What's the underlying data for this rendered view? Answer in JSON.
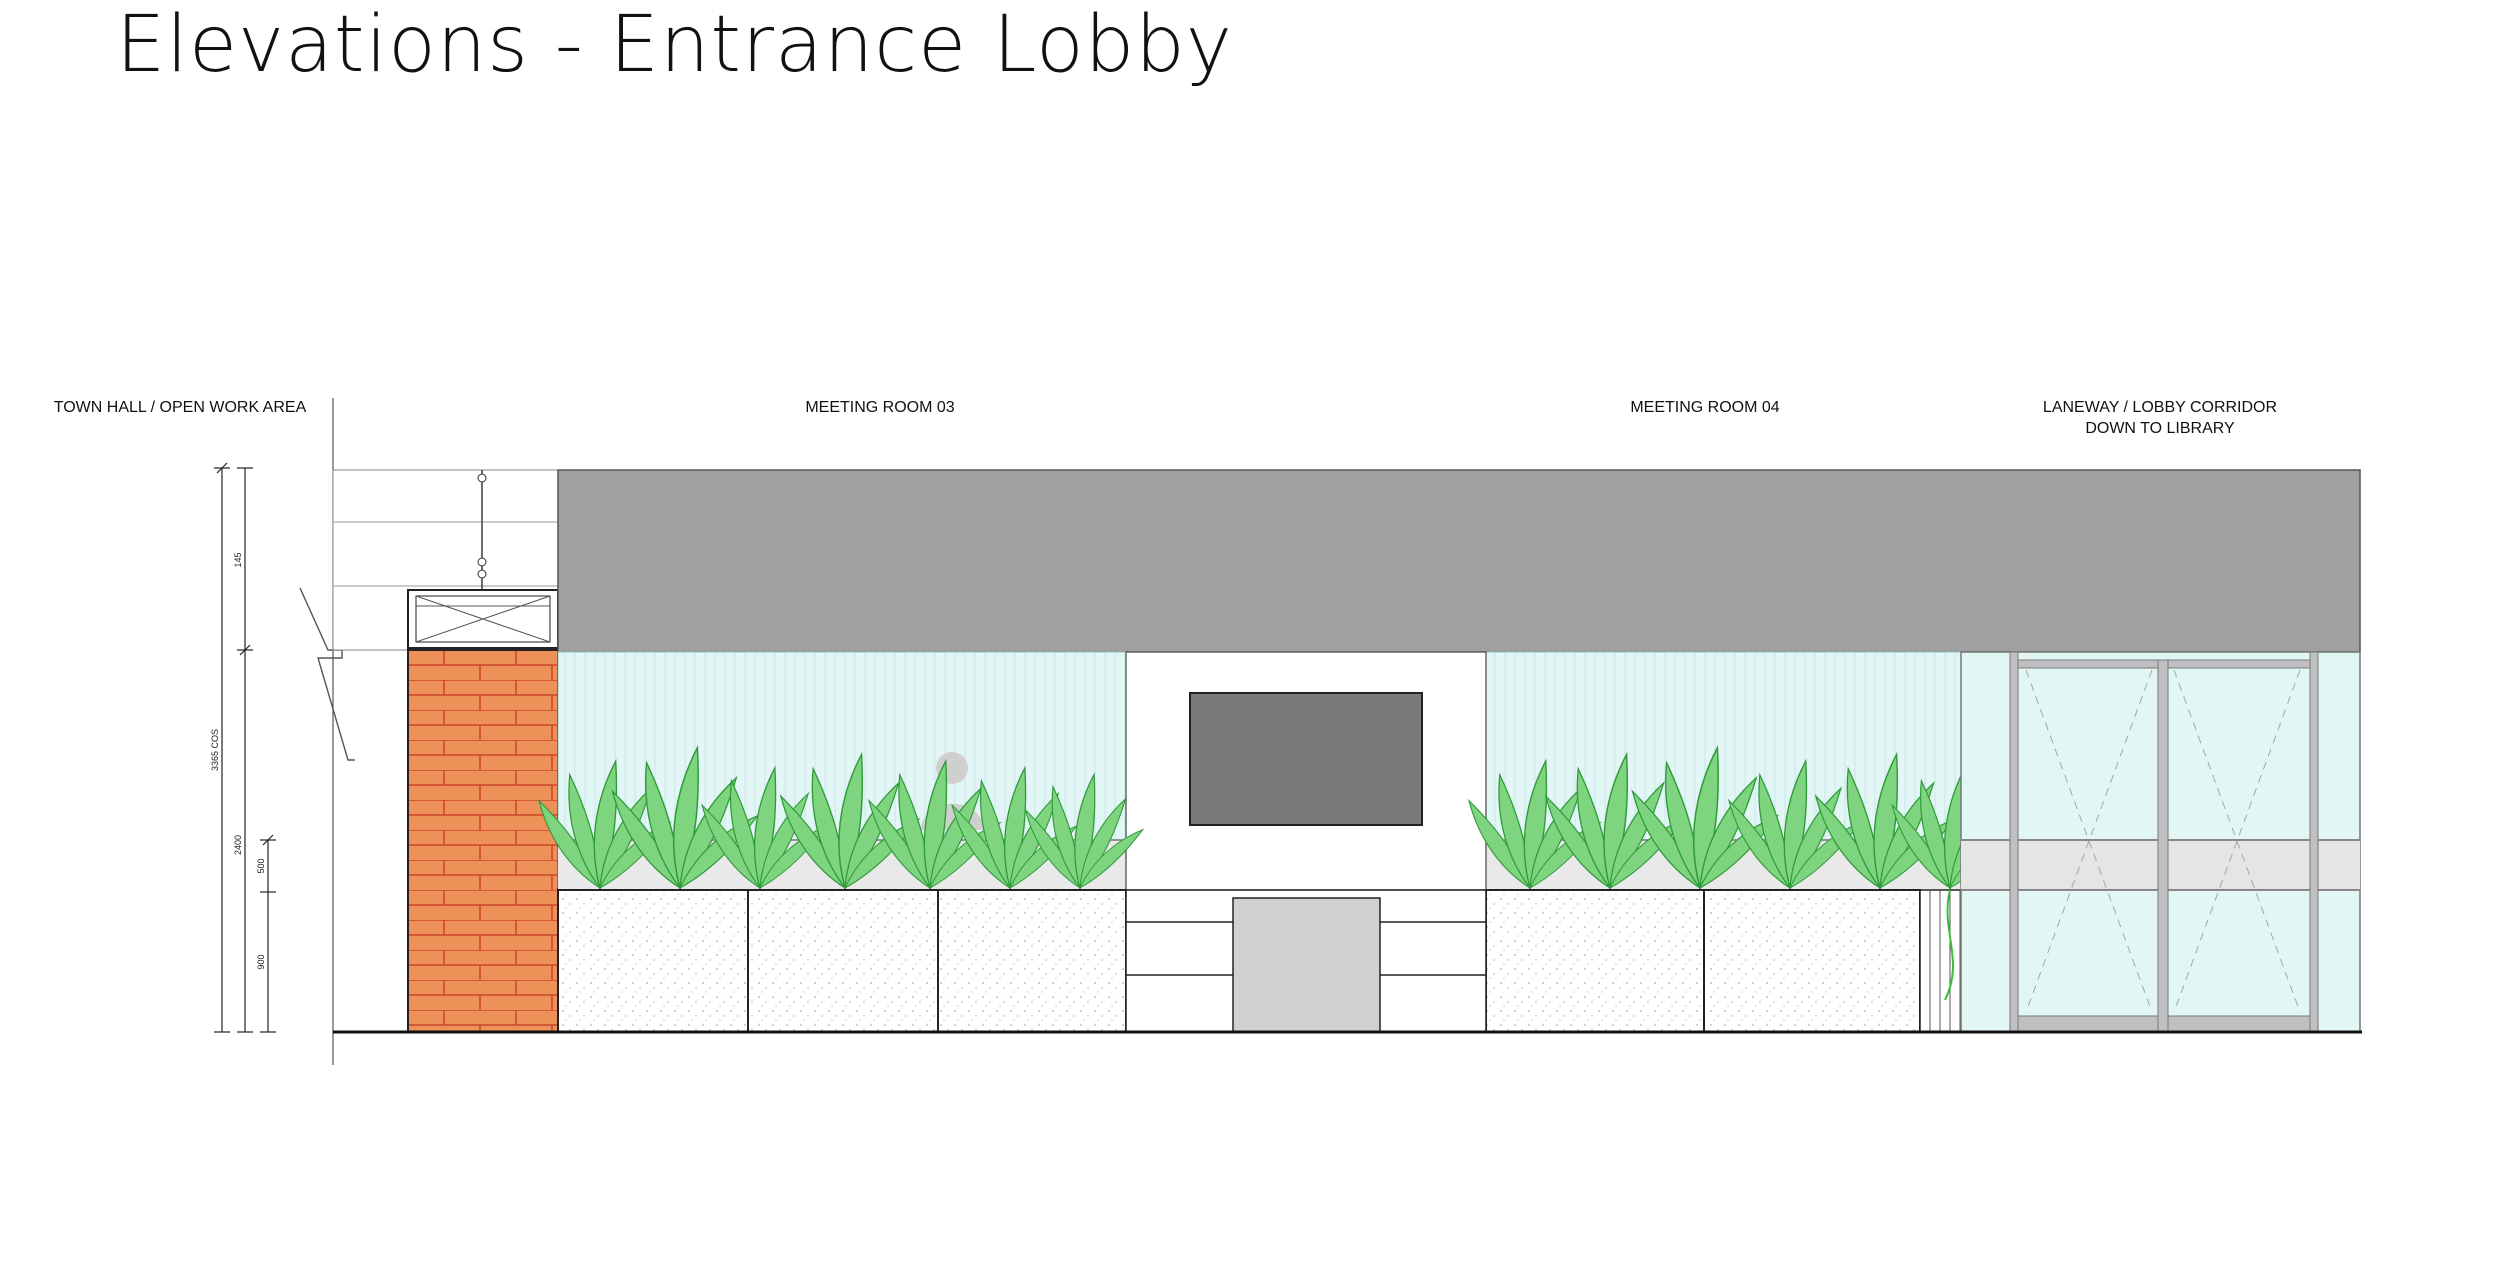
{
  "title": "Elevations - Entrance Lobby",
  "labels": {
    "left_area": "TOWN HALL / OPEN WORK AREA",
    "room_a": "MEETING ROOM 03",
    "room_b": "MEETING ROOM 04",
    "corridor_line1": "LANEWAY / LOBBY CORRIDOR",
    "corridor_line2": "DOWN TO LIBRARY"
  },
  "dimensions": {
    "upper": "145",
    "overall": "3365 COS",
    "wall": "2400",
    "mid": "500",
    "base": "900"
  },
  "colors": {
    "bulkhead": "#a0a0a0",
    "brick": "#ee9159",
    "mortar": "#c8452a",
    "glass": "#e3f6f6",
    "plant": "#6ec96e",
    "screen": "#7a7a7a",
    "joinery_door": "#d0d0d0"
  }
}
